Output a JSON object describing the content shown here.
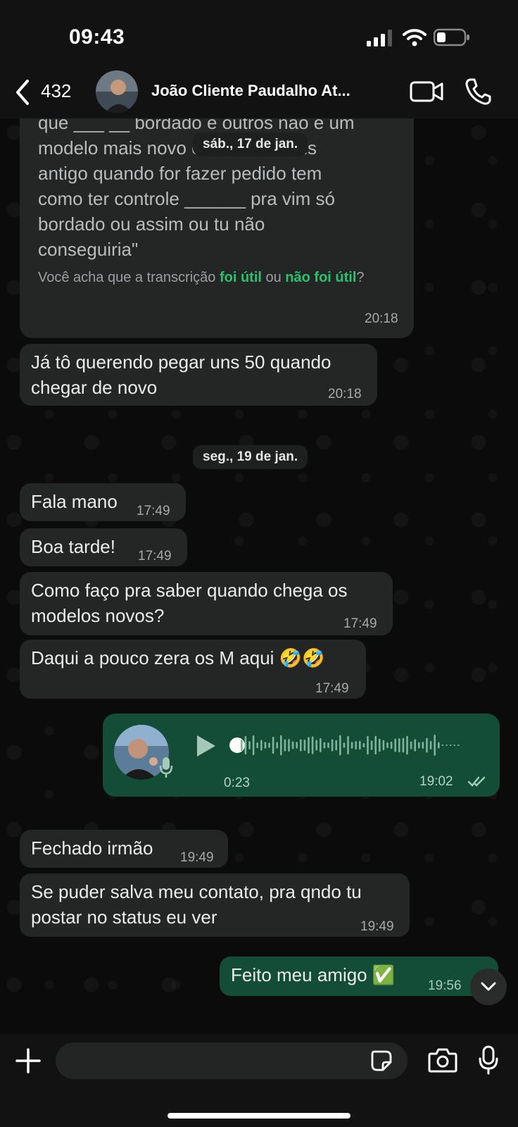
{
  "status_bar": {
    "time": "09:43"
  },
  "header": {
    "back_count": "432",
    "contact_name": "João Cliente  Paudalho At..."
  },
  "transcript": {
    "text_lines": [
      "que ___ __ bordado e outros não é um",
      "modelo mais novo e outros é mais",
      "antigo quando for fazer pedido tem",
      "como ter controle ______ pra vim só",
      "bordado ou assim ou tu não",
      "conseguiria\""
    ],
    "feedback_prefix": "Você acha que a transcrição ",
    "feedback_useful": "foi útil",
    "feedback_or": " ou ",
    "feedback_not_useful": "não foi útil",
    "feedback_suffix": "?",
    "time": "20:18"
  },
  "date_chips": [
    "sáb., 17 de jan.",
    "seg., 19 de jan."
  ],
  "messages": [
    {
      "text": "Já tô querendo pegar uns 50 quando chegar de novo",
      "time": "20:18",
      "direction": "in"
    },
    {
      "text": "Fala mano",
      "time": "17:49",
      "direction": "in"
    },
    {
      "text": "Boa tarde!",
      "time": "17:49",
      "direction": "in"
    },
    {
      "text": "Como faço pra saber quando chega os modelos novos?",
      "time": "17:49",
      "direction": "in"
    },
    {
      "text": "Daqui a pouco zera os M aqui 🤣🤣",
      "time": "17:49",
      "direction": "in"
    },
    {
      "text": "Fechado irmão",
      "time": "19:49",
      "direction": "in"
    },
    {
      "text": "Se puder salva meu contato, pra qndo tu postar no status eu ver",
      "time": "19:49",
      "direction": "in"
    },
    {
      "text": "Feito meu amigo ✅",
      "time": "19:56",
      "direction": "out"
    }
  ],
  "voice_message": {
    "duration": "0:23",
    "time": "19:02",
    "status": "read",
    "played_fraction": 0.0
  },
  "composer": {
    "placeholder": ""
  },
  "colors": {
    "incoming_bubble": "#242626",
    "outgoing_bubble": "#144d37",
    "link_green": "#27c36f",
    "background": "#0b0b0b"
  },
  "icons": [
    "back-chevron-icon",
    "video-call-icon",
    "phone-icon",
    "plus-icon",
    "sticker-icon",
    "camera-icon",
    "mic-icon",
    "play-icon",
    "chevron-down-icon",
    "double-check-icon"
  ]
}
